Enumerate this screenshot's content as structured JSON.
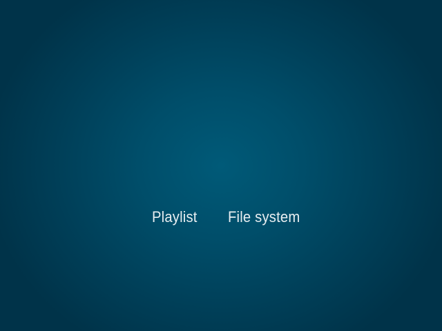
{
  "menu": {
    "items": [
      {
        "label": "Playlist"
      },
      {
        "label": "File system"
      }
    ]
  },
  "colors": {
    "background_center": "#005a78",
    "background_edge": "#003349",
    "text": "#e8eef1"
  }
}
